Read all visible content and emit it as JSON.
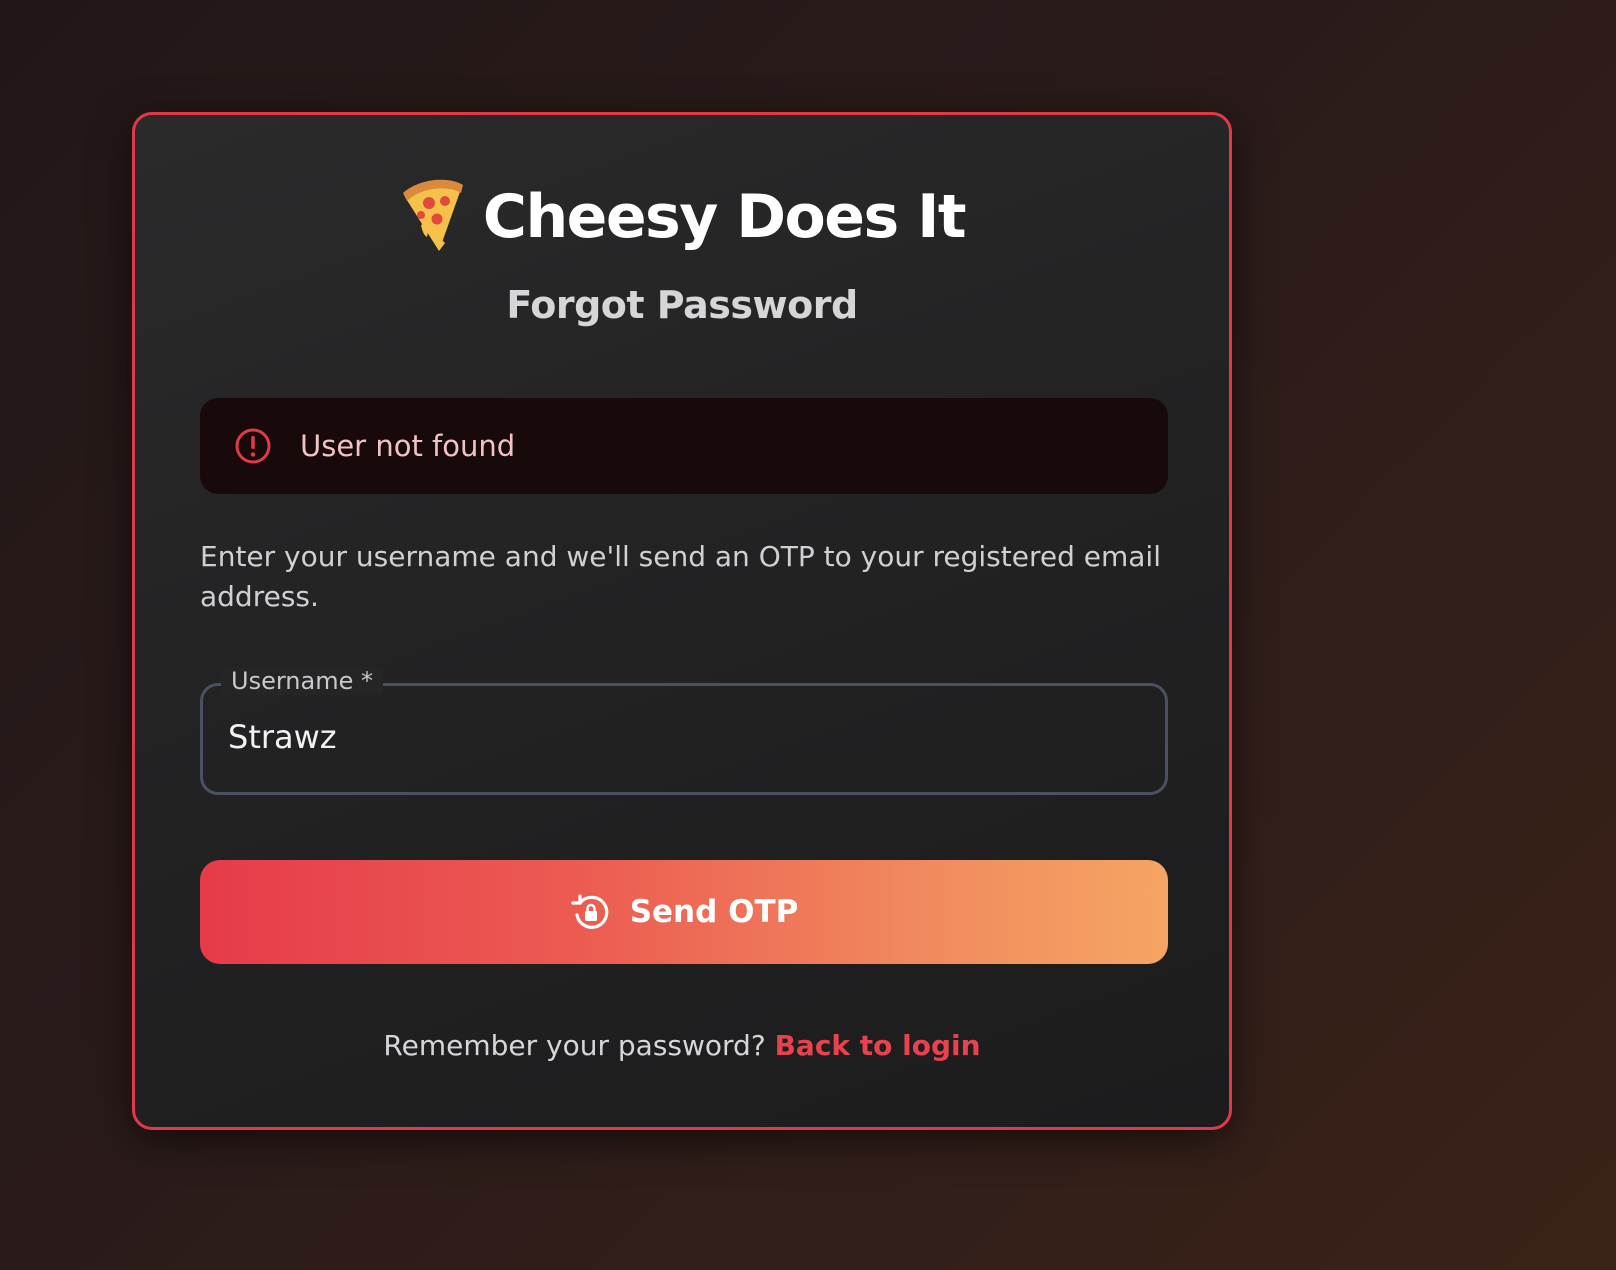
{
  "brand": {
    "title": "Cheesy Does It",
    "icon": "pizza-icon"
  },
  "page_title": "Forgot Password",
  "alert": {
    "icon": "alert-circle-icon",
    "message": "User not found",
    "color": "#e03a48"
  },
  "description": "Enter your username and we'll send an OTP to your registered email address.",
  "username_field": {
    "label": "Username *",
    "value": "Strawz"
  },
  "send_button": {
    "icon": "lock-reset-icon",
    "label": "Send OTP"
  },
  "footer": {
    "prompt": "Remember your password?",
    "link_label": "Back to login"
  },
  "colors": {
    "accent": "#e03a48",
    "button_gradient_start": "#e63b4a",
    "button_gradient_end": "#f5a564"
  }
}
